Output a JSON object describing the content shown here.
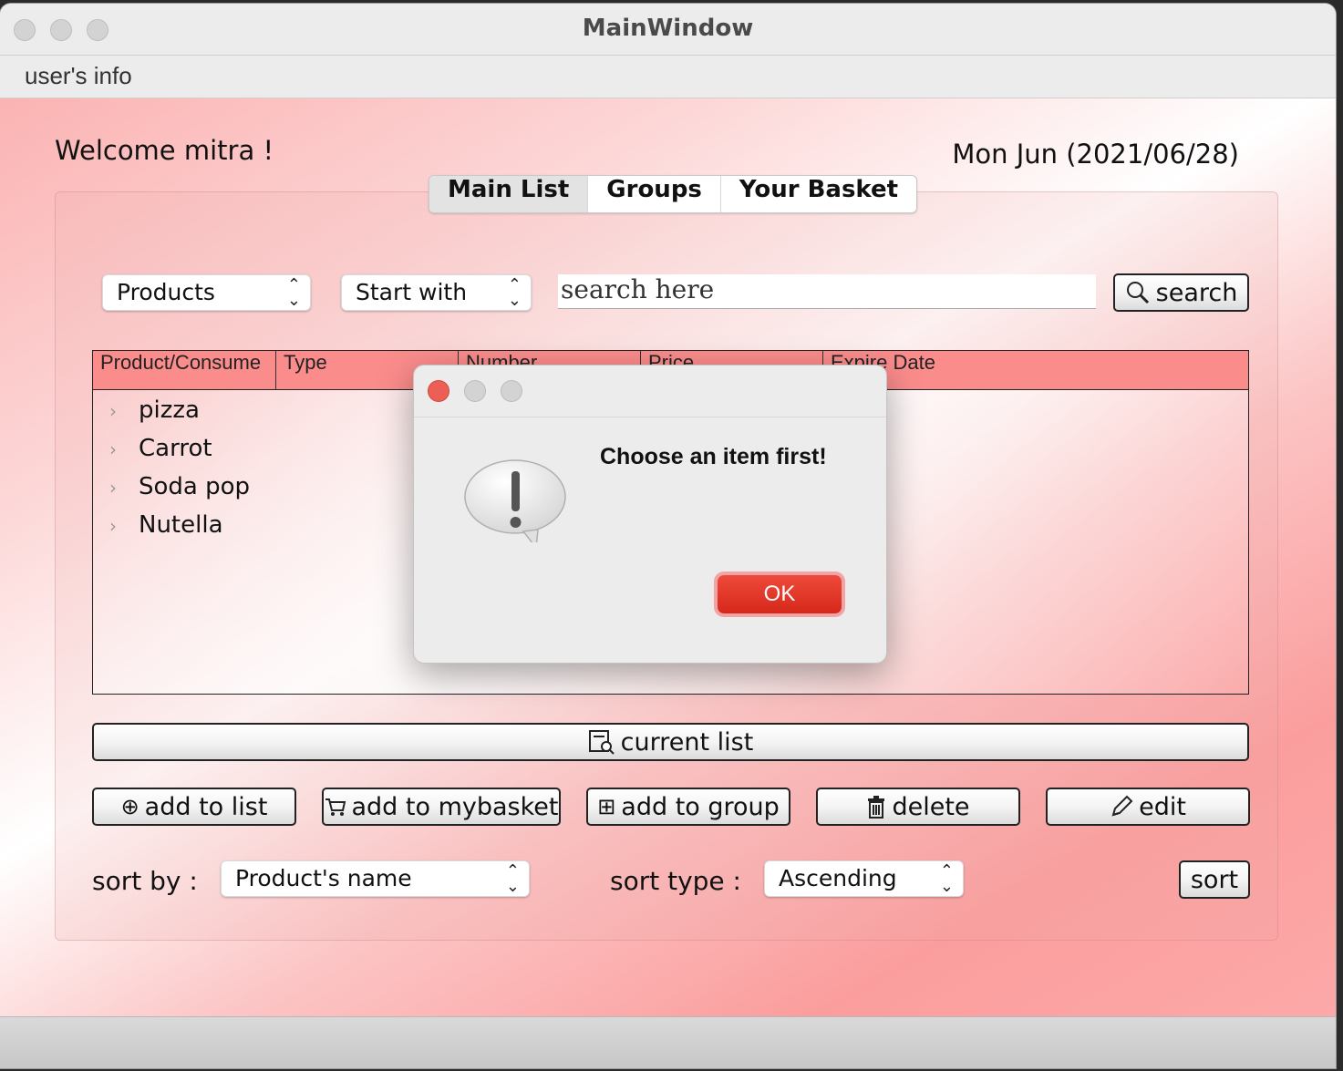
{
  "window": {
    "title": "MainWindow"
  },
  "menu": {
    "user_info": "user's info"
  },
  "header": {
    "welcome": "Welcome mitra !",
    "date": "Mon Jun (2021/06/28)"
  },
  "tabs": [
    {
      "label": "Main List",
      "active": true
    },
    {
      "label": "Groups",
      "active": false
    },
    {
      "label": "Your Basket",
      "active": false
    }
  ],
  "filter": {
    "category": "Products",
    "match": "Start with",
    "search_placeholder": "search here",
    "search_button": "search"
  },
  "table": {
    "columns": [
      "Product/Consume",
      "Type",
      "Number",
      "Price",
      "Expire Date"
    ],
    "rows": [
      "pizza",
      "Carrot",
      "Soda pop",
      "Nutella"
    ]
  },
  "actions": {
    "current_list": "current list",
    "add_to_list": "add to list",
    "add_to_basket": "add to mybasket",
    "add_to_group": "add to group",
    "delete": "delete",
    "edit": "edit"
  },
  "sorting": {
    "sort_by_label": "sort by :",
    "sort_by_value": "Product's name",
    "sort_type_label": "sort type :",
    "sort_type_value": "Ascending",
    "sort_button": "sort"
  },
  "dialog": {
    "message": "Choose an item first!",
    "ok": "OK"
  },
  "colors": {
    "header_row": "#fb8c8c",
    "ok_button": "#e2382a",
    "close_dot": "#ec5f55"
  }
}
